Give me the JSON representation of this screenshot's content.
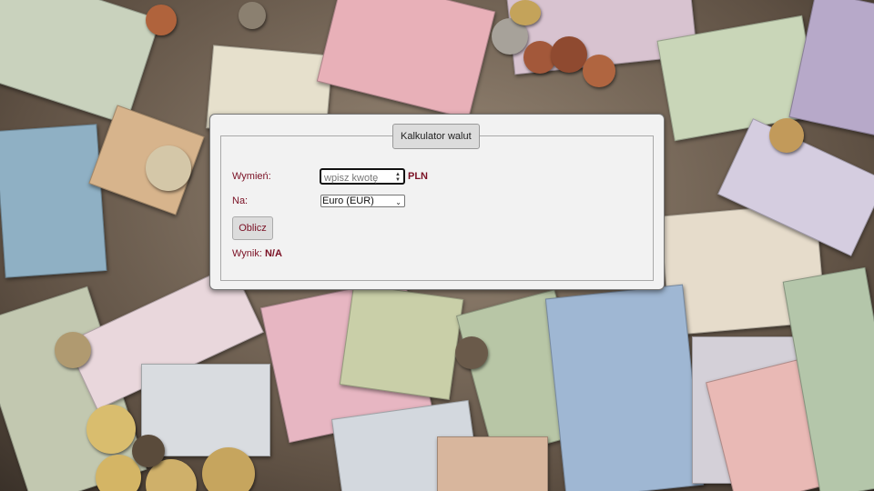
{
  "dialog": {
    "title": "Kalkulator walut",
    "exchange_label": "Wymień:",
    "amount_placeholder": "wpisz kwotę",
    "source_currency": "PLN",
    "target_label": "Na:",
    "target_selected": "Euro (EUR)",
    "calculate_button": "Oblicz",
    "result_label": "Wynik:",
    "result_value": "N/A"
  },
  "colors": {
    "accent": "#7a1024",
    "dialog_bg": "#f2f2f2"
  }
}
